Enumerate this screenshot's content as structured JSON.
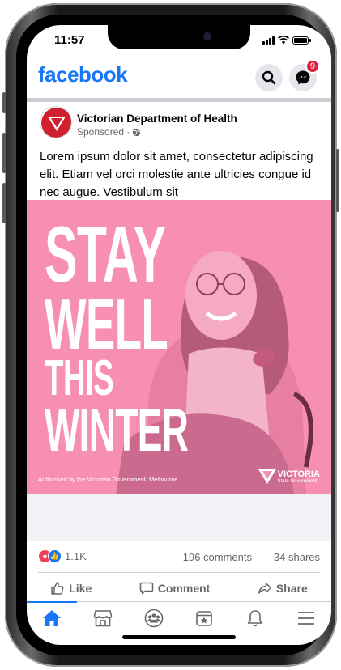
{
  "status_bar": {
    "time": "11:57"
  },
  "header": {
    "logo": "facebook",
    "messenger_badge": "9",
    "search_icon": "search-icon",
    "messenger_icon": "messenger-icon"
  },
  "post": {
    "page_name": "Victorian Department of Health",
    "sponsored_label": "Sponsored ·",
    "text": "Lorem ipsum dolor sit amet, consectetur adipiscing elit. Etiam vel orci molestie ante ultricies congue id nec augue. Vestibulum sit",
    "image": {
      "headline_lines": [
        "STAY",
        "WELL",
        "THIS",
        "WINTER"
      ],
      "authorisation": "Authorised by the Victorian Government, Melbourne.",
      "logo_name": "VICTORIA",
      "logo_sub": "State Government",
      "background_color": "#f68fb0"
    },
    "stats": {
      "reactions_count": "1.1K",
      "comments": "196 comments",
      "shares": "34 shares"
    },
    "actions": {
      "like": "Like",
      "comment": "Comment",
      "share": "Share"
    }
  },
  "bottom_nav": {
    "items": [
      "home-icon",
      "marketplace-icon",
      "groups-icon",
      "pages-icon",
      "notifications-icon",
      "menu-icon"
    ],
    "active": "home-icon"
  },
  "colors": {
    "brand": "#1877f2",
    "badge": "#e41e3f",
    "text_secondary": "#65676b"
  }
}
